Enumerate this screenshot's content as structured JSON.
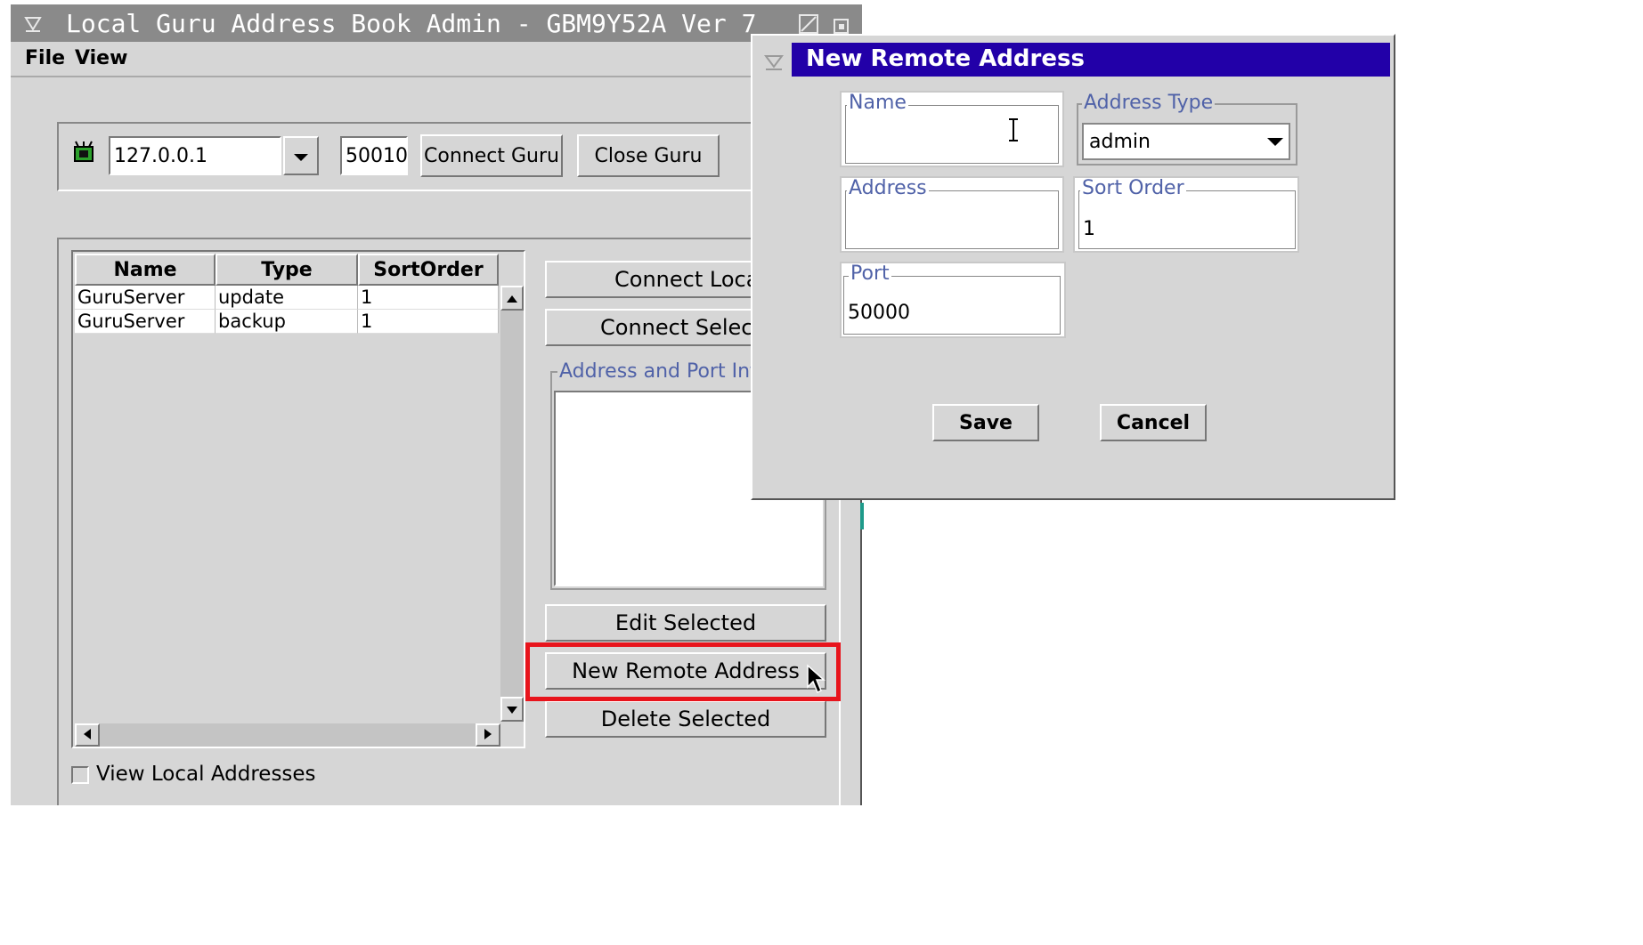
{
  "main_window": {
    "title": "Local Guru Address Book Admin - GBM9Y52A  Ver 7",
    "menu": {
      "file": "File",
      "view": "View"
    },
    "connection": {
      "host_value": "127.0.0.1",
      "port_value": "50010",
      "connect_guru_label": "Connect Guru",
      "close_guru_label": "Close Guru"
    },
    "table": {
      "columns": [
        "Name",
        "Type",
        "SortOrder"
      ],
      "rows": [
        {
          "name": "GuruServer",
          "type": "update",
          "sort_order": "1"
        },
        {
          "name": "GuruServer",
          "type": "backup",
          "sort_order": "1"
        }
      ]
    },
    "actions": {
      "connect_local": "Connect Local",
      "connect_selected": "Connect Selecte",
      "info_group": "Address and Port Info",
      "edit_selected": "Edit Selected",
      "new_remote_address": "New Remote Address",
      "delete_selected": "Delete Selected"
    },
    "view_local_label": "View Local Addresses"
  },
  "dialog": {
    "title": "New Remote Address",
    "name_label": "Name",
    "name_value": "",
    "address_type_label": "Address Type",
    "address_type_value": "admin",
    "address_label": "Address",
    "address_value": "",
    "sort_order_label": "Sort Order",
    "sort_order_value": "1",
    "port_label": "Port",
    "port_value": "50000",
    "save_label": "Save",
    "cancel_label": "Cancel"
  },
  "colors": {
    "dialog_title_bg": "#2200a8",
    "main_title_bg": "#8a8a8a",
    "highlight_box": "#e8141c",
    "group_label": "#5062a8"
  }
}
